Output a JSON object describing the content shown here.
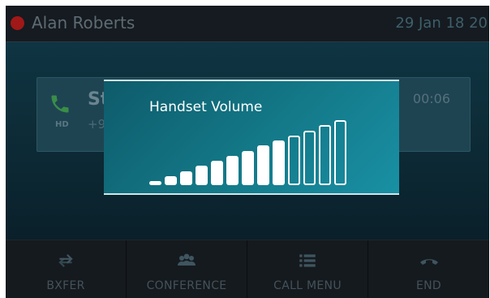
{
  "header": {
    "user_name": "Alan Roberts",
    "date": "29 Jan 18 20"
  },
  "call": {
    "caller_name": "St",
    "caller_number": "+9",
    "hd_label": "HD",
    "timer": "00:06"
  },
  "volume_dialog": {
    "title": "Handset Volume",
    "level": 9,
    "max_level": 13
  },
  "softkeys": [
    {
      "label": "BXFER",
      "icon": "transfer-icon"
    },
    {
      "label": "CONFERENCE",
      "icon": "conference-icon"
    },
    {
      "label": "CALL MENU",
      "icon": "menu-list-icon"
    },
    {
      "label": "END",
      "icon": "hang-up-icon"
    }
  ],
  "colors": {
    "status_dot": "#a01818",
    "dialog_gradient_start": "#0e5b6b",
    "dialog_gradient_end": "#1990a4",
    "call_icon": "#3aa04a"
  }
}
